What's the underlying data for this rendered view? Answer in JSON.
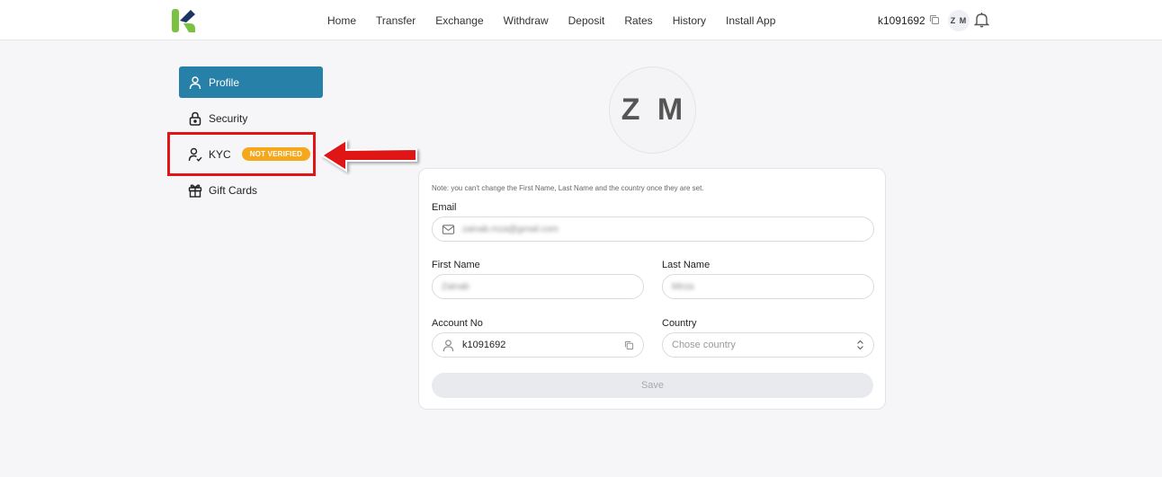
{
  "header": {
    "nav": [
      "Home",
      "Transfer",
      "Exchange",
      "Withdraw",
      "Deposit",
      "Rates",
      "History",
      "Install App"
    ],
    "account_id": "k1091692",
    "avatar_initials": "Z M",
    "colors": {
      "logo_green": "#7cc242",
      "logo_navy": "#1b3663"
    }
  },
  "sidebar": {
    "items": [
      {
        "label": "Profile",
        "icon": "user-icon",
        "active": true
      },
      {
        "label": "Security",
        "icon": "lock-icon"
      },
      {
        "label": "KYC",
        "icon": "user-check-icon",
        "badge": "NOT VERIFIED"
      },
      {
        "label": "Gift Cards",
        "icon": "gift-icon"
      }
    ],
    "active_color": "#2680a8",
    "badge_color": "#f6a81c"
  },
  "profile": {
    "avatar_initials": "Z M",
    "note": "Note: you can't change the First Name, Last Name and the country once they are set.",
    "email_label": "Email",
    "email_value": "zainab.mza@gmail.com",
    "first_name_label": "First Name",
    "first_name_value": "Zainab",
    "last_name_label": "Last Name",
    "last_name_value": "Mirza",
    "account_no_label": "Account No",
    "account_no_value": "k1091692",
    "country_label": "Country",
    "country_placeholder": "Chose country",
    "save_label": "Save"
  },
  "annotation": {
    "color": "#e01616"
  }
}
